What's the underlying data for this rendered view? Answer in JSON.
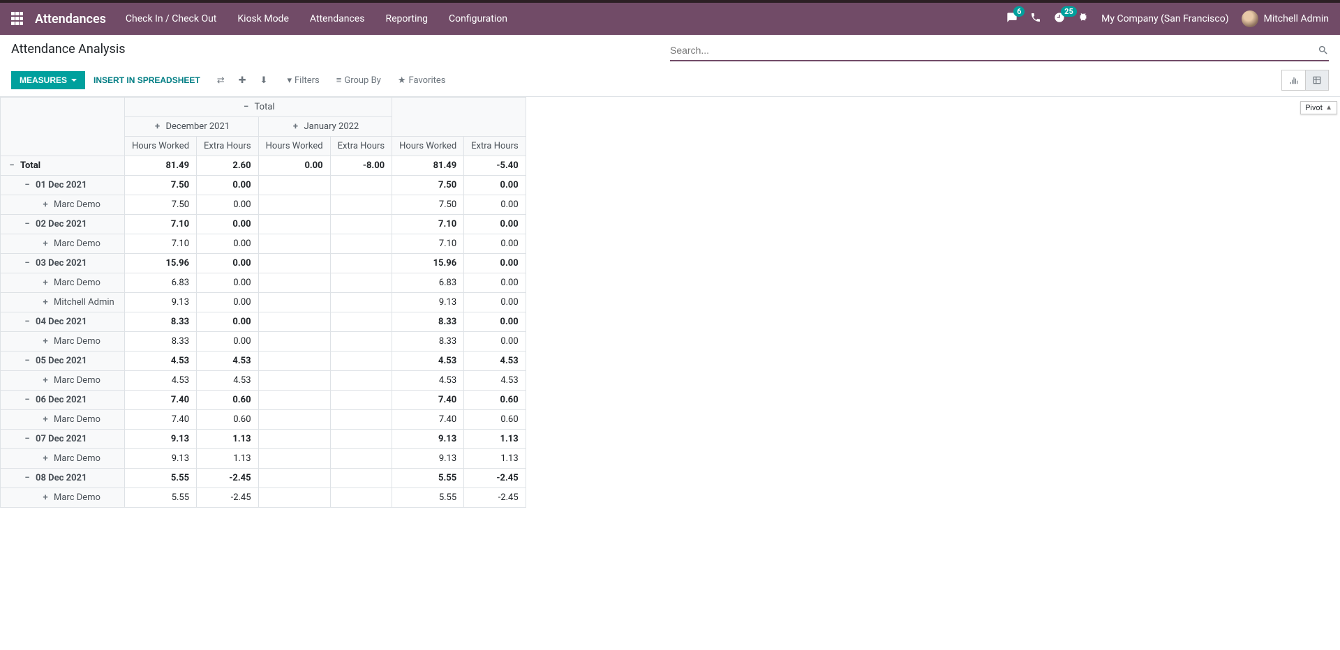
{
  "nav": {
    "brand": "Attendances",
    "menu": [
      "Check In / Check Out",
      "Kiosk Mode",
      "Attendances",
      "Reporting",
      "Configuration"
    ],
    "badge_messages": "6",
    "badge_activities": "25",
    "company": "My Company (San Francisco)",
    "user": "Mitchell Admin"
  },
  "cp": {
    "title": "Attendance Analysis",
    "search_placeholder": "Search...",
    "measures_label": "MEASURES",
    "spreadsheet_label": "INSERT IN SPREADSHEET",
    "filters": "Filters",
    "groupby": "Group By",
    "favorites": "Favorites",
    "tooltip": "Pivot"
  },
  "pivot": {
    "total_label": "Total",
    "col_groups": [
      "December 2021",
      "January 2022"
    ],
    "measures": [
      "Hours Worked",
      "Extra Hours"
    ],
    "rows": [
      {
        "type": "total",
        "label": "Total",
        "dec": [
          "81.49",
          "2.60"
        ],
        "jan": [
          "0.00",
          "-8.00"
        ],
        "tot": [
          "81.49",
          "-5.40"
        ]
      },
      {
        "type": "date",
        "label": "01 Dec 2021",
        "dec": [
          "7.50",
          "0.00"
        ],
        "jan": [
          "",
          ""
        ],
        "tot": [
          "7.50",
          "0.00"
        ]
      },
      {
        "type": "emp",
        "label": "Marc Demo",
        "dec": [
          "7.50",
          "0.00"
        ],
        "jan": [
          "",
          ""
        ],
        "tot": [
          "7.50",
          "0.00"
        ]
      },
      {
        "type": "date",
        "label": "02 Dec 2021",
        "dec": [
          "7.10",
          "0.00"
        ],
        "jan": [
          "",
          ""
        ],
        "tot": [
          "7.10",
          "0.00"
        ]
      },
      {
        "type": "emp",
        "label": "Marc Demo",
        "dec": [
          "7.10",
          "0.00"
        ],
        "jan": [
          "",
          ""
        ],
        "tot": [
          "7.10",
          "0.00"
        ]
      },
      {
        "type": "date",
        "label": "03 Dec 2021",
        "dec": [
          "15.96",
          "0.00"
        ],
        "jan": [
          "",
          ""
        ],
        "tot": [
          "15.96",
          "0.00"
        ]
      },
      {
        "type": "emp",
        "label": "Marc Demo",
        "dec": [
          "6.83",
          "0.00"
        ],
        "jan": [
          "",
          ""
        ],
        "tot": [
          "6.83",
          "0.00"
        ]
      },
      {
        "type": "emp",
        "label": "Mitchell Admin",
        "dec": [
          "9.13",
          "0.00"
        ],
        "jan": [
          "",
          ""
        ],
        "tot": [
          "9.13",
          "0.00"
        ]
      },
      {
        "type": "date",
        "label": "04 Dec 2021",
        "dec": [
          "8.33",
          "0.00"
        ],
        "jan": [
          "",
          ""
        ],
        "tot": [
          "8.33",
          "0.00"
        ]
      },
      {
        "type": "emp",
        "label": "Marc Demo",
        "dec": [
          "8.33",
          "0.00"
        ],
        "jan": [
          "",
          ""
        ],
        "tot": [
          "8.33",
          "0.00"
        ]
      },
      {
        "type": "date",
        "label": "05 Dec 2021",
        "dec": [
          "4.53",
          "4.53"
        ],
        "jan": [
          "",
          ""
        ],
        "tot": [
          "4.53",
          "4.53"
        ]
      },
      {
        "type": "emp",
        "label": "Marc Demo",
        "dec": [
          "4.53",
          "4.53"
        ],
        "jan": [
          "",
          ""
        ],
        "tot": [
          "4.53",
          "4.53"
        ]
      },
      {
        "type": "date",
        "label": "06 Dec 2021",
        "dec": [
          "7.40",
          "0.60"
        ],
        "jan": [
          "",
          ""
        ],
        "tot": [
          "7.40",
          "0.60"
        ]
      },
      {
        "type": "emp",
        "label": "Marc Demo",
        "dec": [
          "7.40",
          "0.60"
        ],
        "jan": [
          "",
          ""
        ],
        "tot": [
          "7.40",
          "0.60"
        ]
      },
      {
        "type": "date",
        "label": "07 Dec 2021",
        "dec": [
          "9.13",
          "1.13"
        ],
        "jan": [
          "",
          ""
        ],
        "tot": [
          "9.13",
          "1.13"
        ]
      },
      {
        "type": "emp",
        "label": "Marc Demo",
        "dec": [
          "9.13",
          "1.13"
        ],
        "jan": [
          "",
          ""
        ],
        "tot": [
          "9.13",
          "1.13"
        ]
      },
      {
        "type": "date",
        "label": "08 Dec 2021",
        "dec": [
          "5.55",
          "-2.45"
        ],
        "jan": [
          "",
          ""
        ],
        "tot": [
          "5.55",
          "-2.45"
        ]
      },
      {
        "type": "emp",
        "label": "Marc Demo",
        "dec": [
          "5.55",
          "-2.45"
        ],
        "jan": [
          "",
          ""
        ],
        "tot": [
          "5.55",
          "-2.45"
        ]
      }
    ]
  }
}
